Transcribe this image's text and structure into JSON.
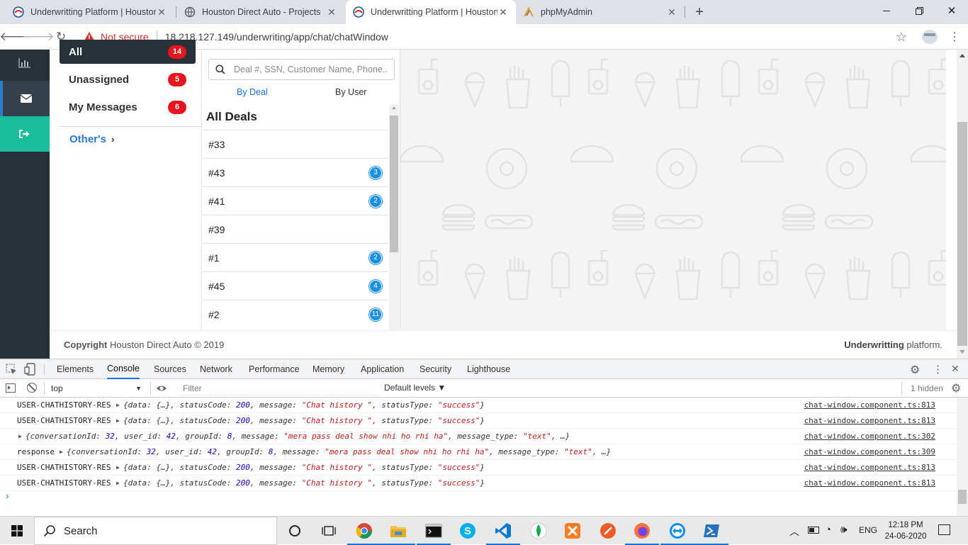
{
  "browser": {
    "tabs": [
      {
        "title": "Underwritting Platform | Houston",
        "active": false
      },
      {
        "title": "Houston Direct Auto - Projects",
        "active": false
      },
      {
        "title": "Underwritting Platform | Houston",
        "active": true
      },
      {
        "title": "phpMyAdmin",
        "active": false
      }
    ],
    "new_tab": "+",
    "security": "Not secure",
    "url": "18.218.127.149/underwriting/app/chat/chatWindow"
  },
  "filters": {
    "items": [
      {
        "label": "All",
        "count": "14"
      },
      {
        "label": "Unassigned",
        "count": "5"
      },
      {
        "label": "My Messages",
        "count": "6"
      }
    ],
    "others": "Other's"
  },
  "deals": {
    "search_placeholder": "Deal #, SSN, Customer Name, Phone..",
    "tab_by_deal": "By Deal",
    "tab_by_user": "By User",
    "heading": "All Deals",
    "list": [
      {
        "id": "#33",
        "count": ""
      },
      {
        "id": "#43",
        "count": "3"
      },
      {
        "id": "#41",
        "count": "2"
      },
      {
        "id": "#39",
        "count": ""
      },
      {
        "id": "#1",
        "count": "2"
      },
      {
        "id": "#45",
        "count": "4"
      },
      {
        "id": "#2",
        "count": "11"
      }
    ]
  },
  "footer": {
    "copyright_bold": "Copyright",
    "copyright_rest": "Houston Direct Auto © 2019",
    "brand_bold": "Underwritting",
    "brand_rest": "platform."
  },
  "devtools": {
    "tabs": [
      "Elements",
      "Console",
      "Sources",
      "Network",
      "Performance",
      "Memory",
      "Application",
      "Security",
      "Lighthouse"
    ],
    "active_tab": "Console",
    "context": "top",
    "filter_placeholder": "Filter",
    "levels": "Default levels ▼",
    "hidden": "1 hidden",
    "logs": [
      {
        "label": "USER-CHATHISTORY-RES",
        "obj": "{data: {…}, statusCode: 200, message: \"Chat history \", statusType: \"success\"}",
        "source": "chat-window.component.ts:813"
      },
      {
        "label": "USER-CHATHISTORY-RES",
        "obj": "{data: {…}, statusCode: 200, message: \"Chat history \", statusType: \"success\"}",
        "source": "chat-window.component.ts:813"
      },
      {
        "label": "",
        "obj": "{conversationId: 32, user_id: 42, groupId: 8, message: \"mera pass deal show nhi ho rhi ha\", message_type: \"text\", …}",
        "source": "chat-window.component.ts:302"
      },
      {
        "label": "response",
        "obj": "{conversationId: 32, user_id: 42, groupId: 8, message: \"mera pass deal show nhi ho rhi ha\", message_type: \"text\", …}",
        "source": "chat-window.component.ts:309"
      },
      {
        "label": "USER-CHATHISTORY-RES",
        "obj": "{data: {…}, statusCode: 200, message: \"Chat history \", statusType: \"success\"}",
        "source": "chat-window.component.ts:813"
      },
      {
        "label": "USER-CHATHISTORY-RES",
        "obj": "{data: {…}, statusCode: 200, message: \"Chat history \", statusType: \"success\"}",
        "source": "chat-window.component.ts:813"
      }
    ],
    "prompt": "›"
  },
  "taskbar": {
    "search": "Search",
    "lang": "ENG",
    "time": "12:18 PM",
    "date": "24-06-2020"
  },
  "colors": {
    "rail": "#263238",
    "rail_active": "#1abc9c",
    "badge_red": "#e8141e",
    "count_blue": "#1a8fe3",
    "link_blue": "#2b7bd0"
  }
}
